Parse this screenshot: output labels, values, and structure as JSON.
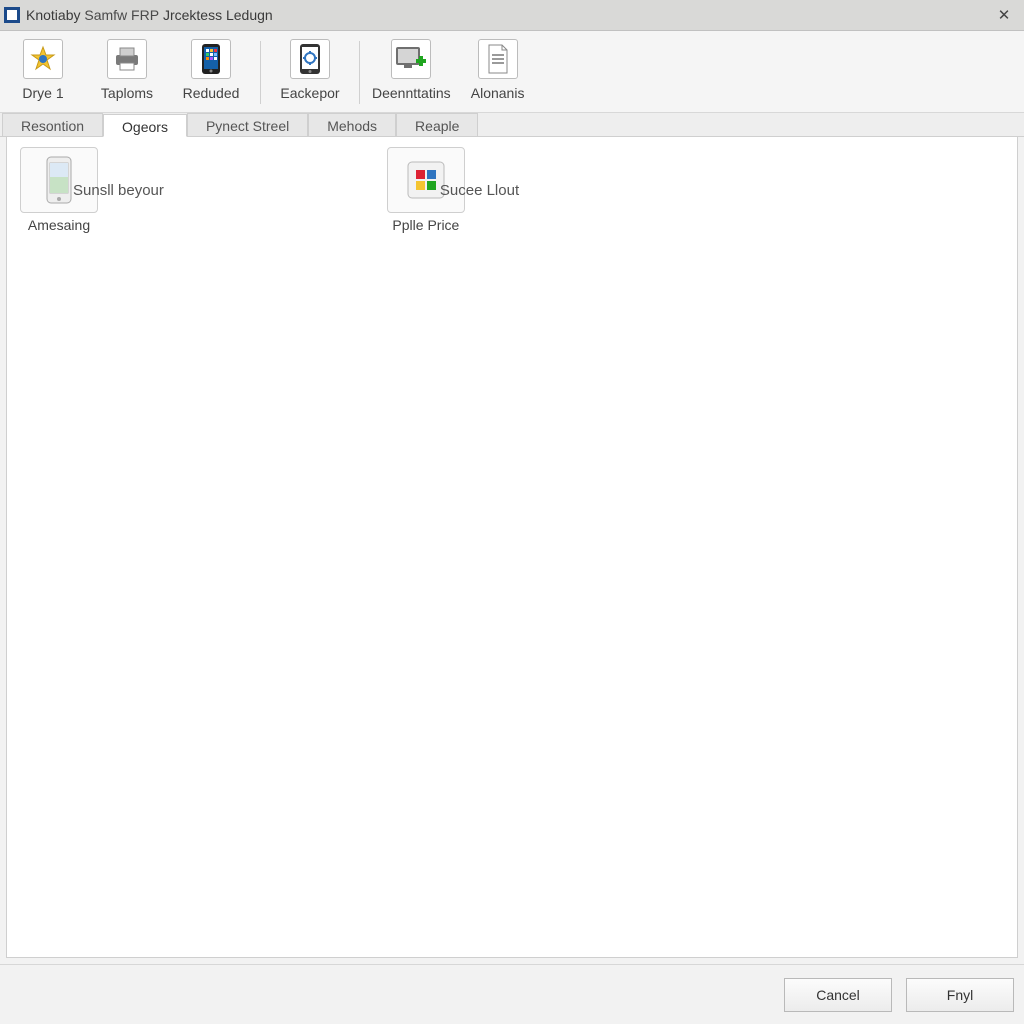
{
  "window": {
    "title_prefix": "Knotiaby",
    "title_middle": "Samfw FRP",
    "title_suffix": "Jrcektess Ledugn"
  },
  "toolbar": {
    "items": [
      {
        "id": "drye1",
        "label": "Drye 1",
        "icon": "star-person"
      },
      {
        "id": "taploms",
        "label": "Taploms",
        "icon": "printer"
      },
      {
        "id": "reduded",
        "label": "Reduded",
        "icon": "smartphone-apps"
      },
      {
        "id": "eackepor",
        "label": "Eackepor",
        "icon": "tablet-gear"
      },
      {
        "id": "deennttatins",
        "label": "Deennttatins",
        "icon": "monitor-plus"
      },
      {
        "id": "alonanis",
        "label": "Alonanis",
        "icon": "document"
      }
    ],
    "separators_after": [
      2,
      3
    ]
  },
  "tabs": {
    "active_index": 1,
    "items": [
      {
        "id": "resontion",
        "label": "Resontion"
      },
      {
        "id": "ogeors",
        "label": "Ogeors"
      },
      {
        "id": "pynect-streel",
        "label": "Pynect Streel"
      },
      {
        "id": "mehods",
        "label": "Mehods"
      },
      {
        "id": "reaple",
        "label": "Reaple"
      }
    ]
  },
  "content": {
    "cards": [
      {
        "id": "amesaing",
        "label": "Amesaing",
        "side": "Sunsll beyour",
        "icon": "phone-photo"
      },
      {
        "id": "pplle-price",
        "label": "Pplle Price",
        "side": "Sucee Llout",
        "icon": "grid-colors"
      }
    ]
  },
  "footer": {
    "cancel": "Cancel",
    "finish": "Fnyl"
  },
  "colors": {
    "accent_green": "#1fa51f",
    "accent_blue": "#2f74c0"
  }
}
